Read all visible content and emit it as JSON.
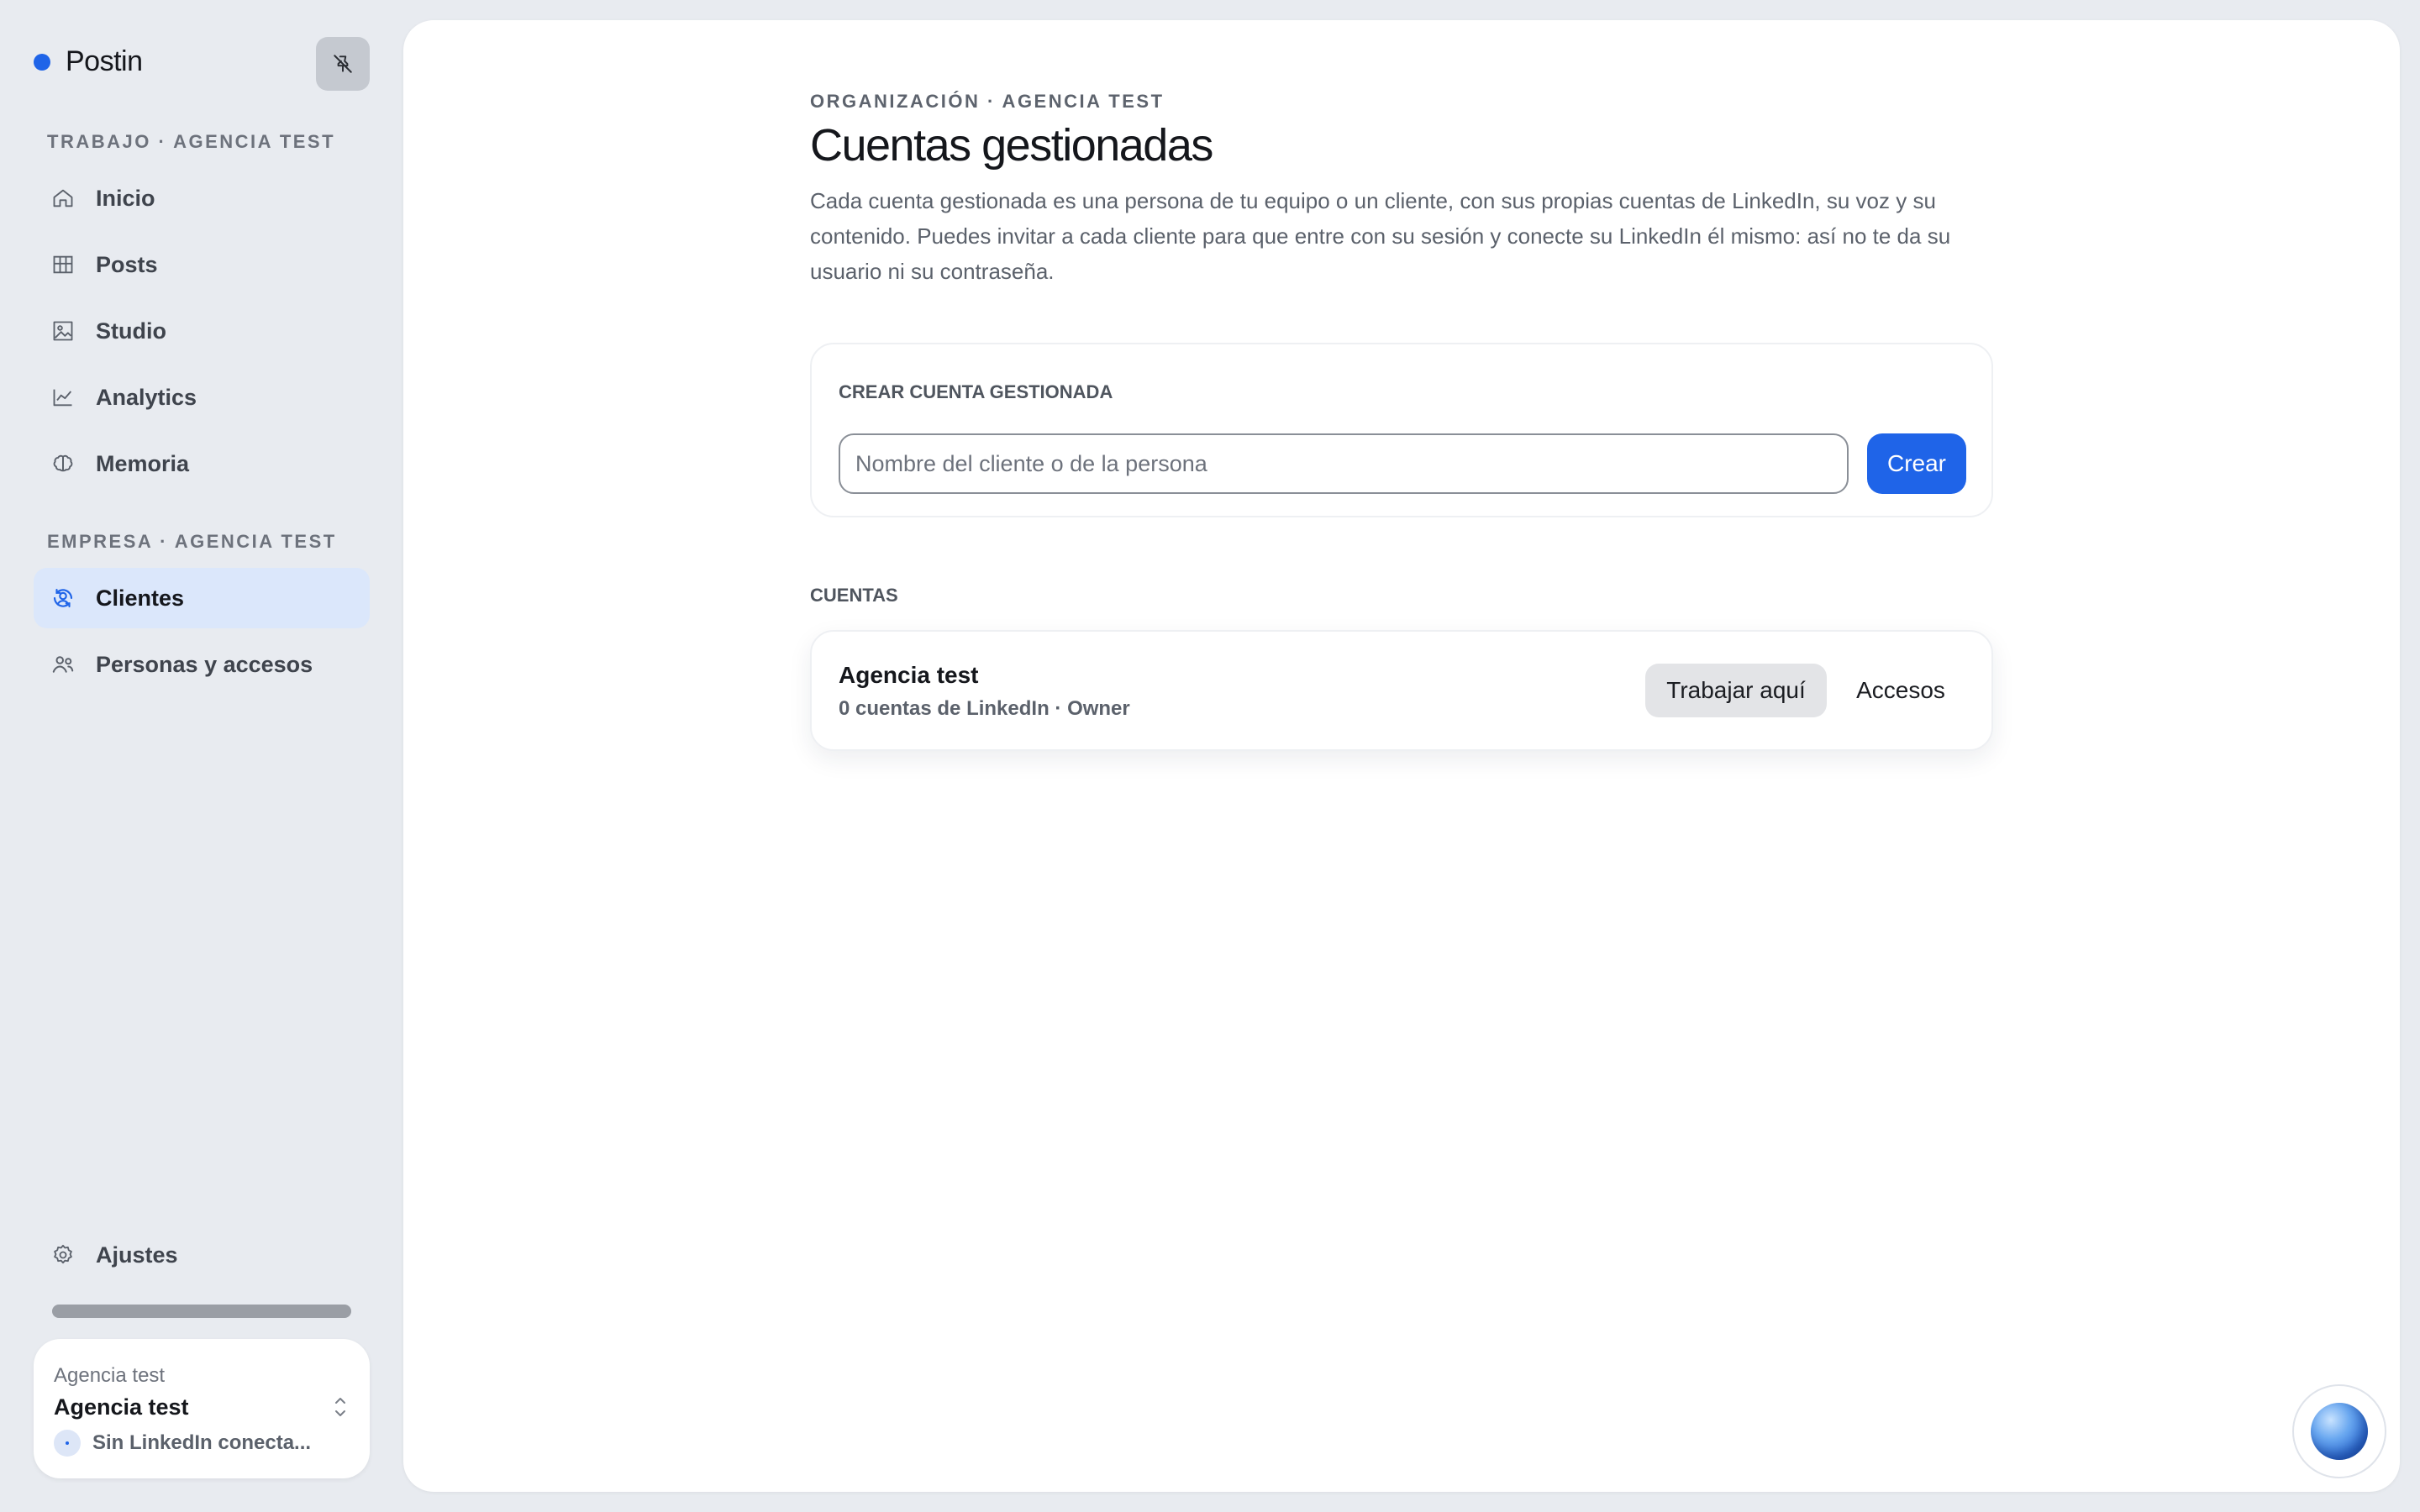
{
  "sidebar": {
    "brand": "Postin",
    "work_section": "Trabajo · Agencia test",
    "work_items": [
      {
        "label": "Inicio",
        "icon": "home-icon"
      },
      {
        "label": "Posts",
        "icon": "grid-icon"
      },
      {
        "label": "Studio",
        "icon": "image-icon"
      },
      {
        "label": "Analytics",
        "icon": "chart-icon"
      },
      {
        "label": "Memoria",
        "icon": "brain-icon"
      }
    ],
    "company_section": "Empresa · Agencia test",
    "company_items": [
      {
        "label": "Clientes",
        "icon": "clients-icon",
        "active": true
      },
      {
        "label": "Personas y accesos",
        "icon": "people-icon"
      }
    ],
    "settings": {
      "label": "Ajustes",
      "icon": "gear-icon"
    },
    "account": {
      "org": "Agencia test",
      "name": "Agencia test",
      "status": "Sin LinkedIn conecta..."
    }
  },
  "main": {
    "breadcrumb": "Organización · Agencia test",
    "title": "Cuentas gestionadas",
    "description": "Cada cuenta gestionada es una persona de tu equipo o un cliente, con sus propias cuentas de LinkedIn, su voz y su contenido. Puedes invitar a cada cliente para que entre con su sesión y conecte su LinkedIn él mismo: así no te da su usuario ni su contraseña.",
    "create": {
      "label": "Crear cuenta gestionada",
      "placeholder": "Nombre del cliente o de la persona",
      "button": "Crear"
    },
    "accounts_label": "Cuentas",
    "accounts": [
      {
        "name": "Agencia test",
        "meta": "0 cuentas de LinkedIn · Owner",
        "work_button": "Trabajar aquí",
        "access_button": "Accesos"
      }
    ]
  },
  "colors": {
    "accent": "#1f64e8",
    "active_nav_bg": "#dbe7fb",
    "page_bg": "#e8ebf0"
  }
}
